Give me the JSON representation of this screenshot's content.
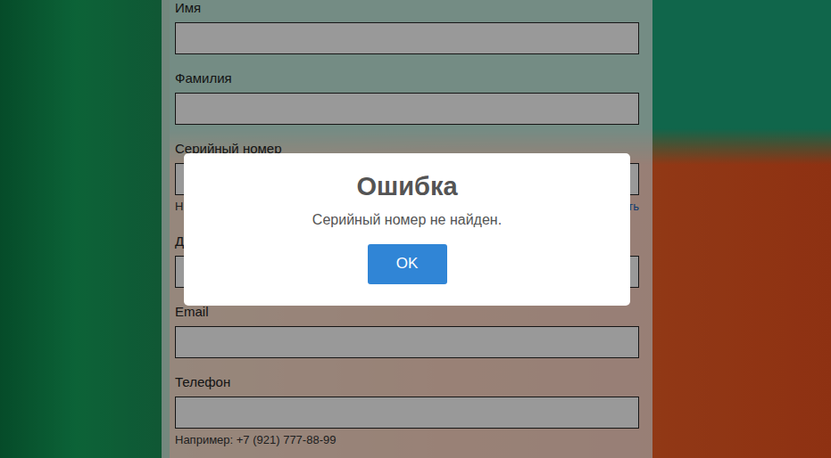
{
  "form": {
    "fields": [
      {
        "label": "Имя",
        "value": "",
        "hints": []
      },
      {
        "label": "Фамилия",
        "value": "",
        "hints": []
      },
      {
        "label": "Серийный номер",
        "value": "",
        "hints": [
          "Н",
          "ть"
        ]
      },
      {
        "label": "Д",
        "value": "",
        "hints": []
      },
      {
        "label": "Email",
        "value": "",
        "hints": []
      },
      {
        "label": "Телефон",
        "value": "",
        "hints": [
          "Например: +7 (921) 777-88-99"
        ]
      }
    ]
  },
  "dialog": {
    "title": "Ошибка",
    "message": "Серийный номер не найден.",
    "buttons": [
      "OK"
    ]
  }
}
